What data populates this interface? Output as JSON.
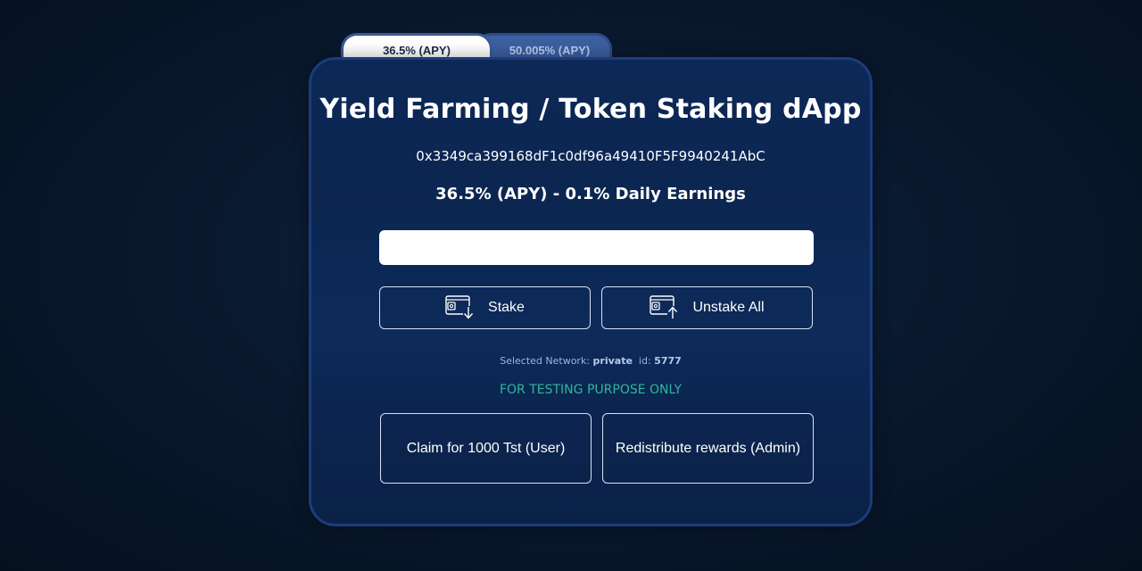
{
  "tabs": [
    {
      "label": "36.5% (APY)",
      "active": true
    },
    {
      "label": "50.005% (APY)",
      "active": false
    }
  ],
  "card": {
    "title": "Yield Farming / Token Staking dApp",
    "address": "0x3349ca399168dF1c0df96a49410F5F9940241AbC",
    "apy_text": "36.5% (APY) - 0.1% Daily Earnings"
  },
  "amount_input": {
    "value": "",
    "placeholder": ""
  },
  "actions": {
    "stake_label": "Stake",
    "stake_icon": "wallet-withdraw-icon",
    "unstake_label": "Unstake All",
    "unstake_icon": "wallet-deposit-icon"
  },
  "network": {
    "prefix": "Selected Network:",
    "name": "private",
    "id_label": "id:",
    "id": "5777"
  },
  "testing_note": "FOR TESTING PURPOSE ONLY",
  "testing_actions": {
    "claim_label": "Claim for 1000 Tst (User)",
    "redistribute_label": "Redistribute rewards (Admin)"
  },
  "colors": {
    "background": "#06111f",
    "card": "#0c2856",
    "card_border": "#1c3c7c",
    "active_tab": "#ffffff",
    "inactive_tab": "#3c5fa0",
    "testing_text": "#2fb79a"
  }
}
